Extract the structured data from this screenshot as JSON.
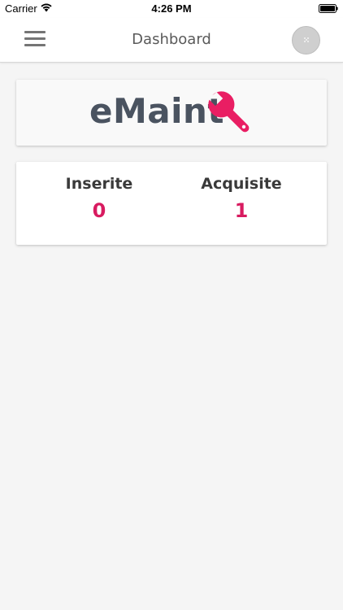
{
  "status_bar": {
    "carrier": "Carrier",
    "time": "4:26 PM"
  },
  "nav": {
    "title": "Dashboard",
    "menu_icon": "hamburger-menu-icon",
    "avatar_icon": "user-avatar-icon"
  },
  "logo": {
    "text": "eMaint",
    "icon": "wrench-icon",
    "text_color": "#4a5360",
    "icon_color": "#e91e63"
  },
  "stats": [
    {
      "label": "Inserite",
      "value": "0"
    },
    {
      "label": "Acquisite",
      "value": "1"
    }
  ],
  "colors": {
    "accent": "#d81b60",
    "background": "#f5f5f5",
    "card": "#ffffff"
  }
}
